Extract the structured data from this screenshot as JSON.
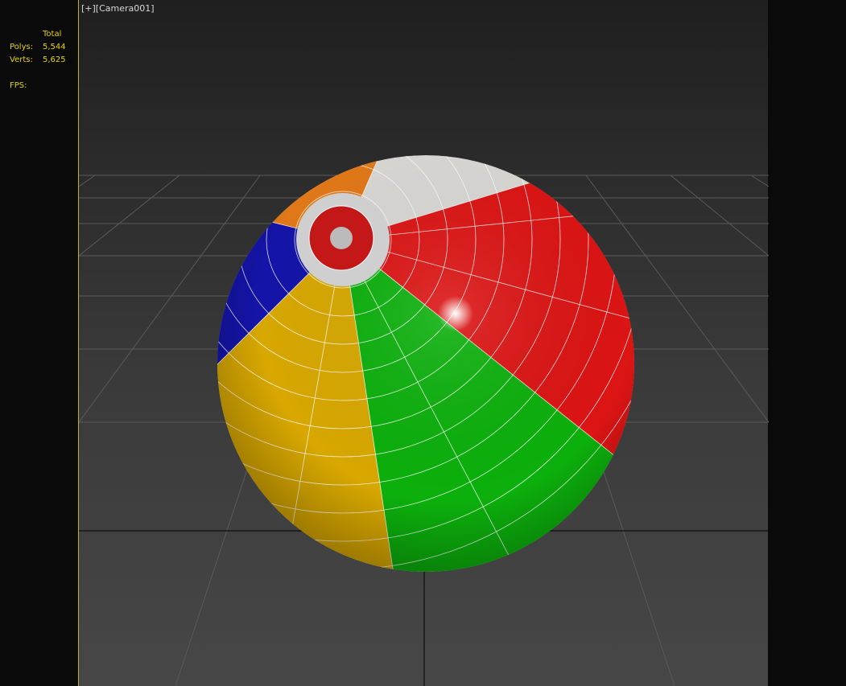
{
  "viewport": {
    "label": "[+][Camera001]"
  },
  "stats": {
    "header": "Total",
    "polys_label": "Polys:",
    "polys": "5,544",
    "verts_label": "Verts:",
    "verts": "5,625",
    "fps_label": "FPS:"
  },
  "colors": {
    "white": "#d9d7d4",
    "red": "#dc1414",
    "green": "#0cb00c",
    "yellow": "#d8a800",
    "blue": "#1414a8",
    "orange": "#e07818",
    "border": "#c8b400"
  }
}
